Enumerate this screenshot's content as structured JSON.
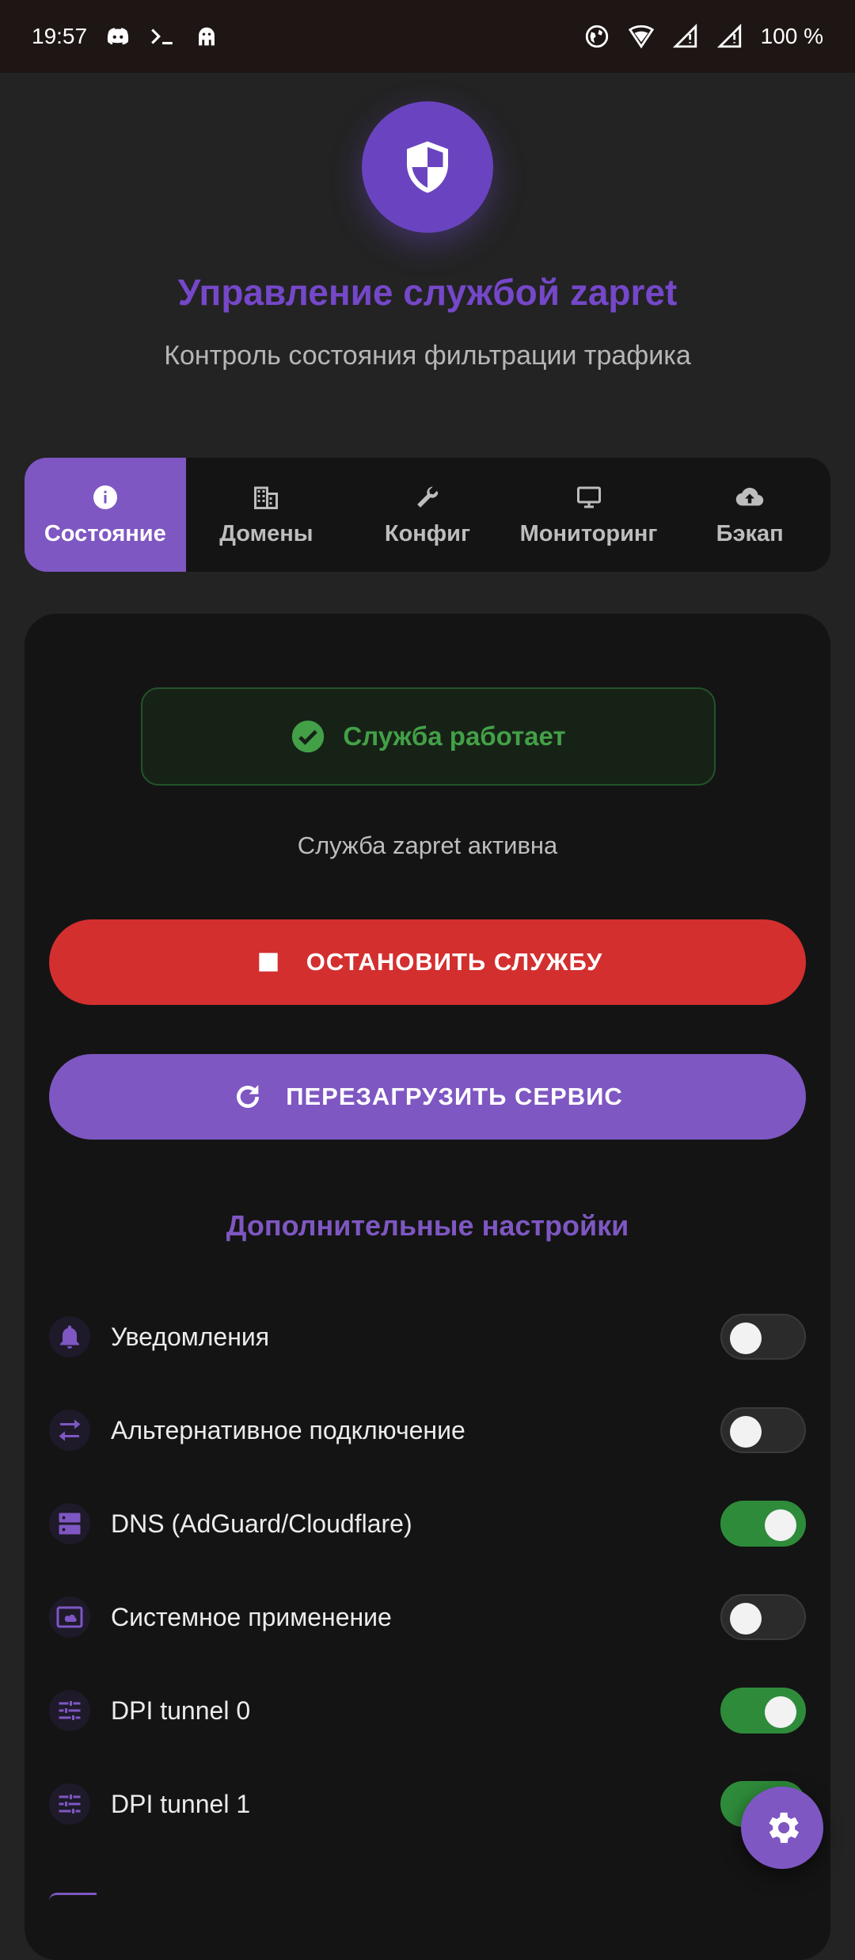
{
  "status_bar": {
    "time": "19:57",
    "battery": "100 %",
    "left_icons": [
      "discord-icon",
      "terminal-icon",
      "android-icon"
    ],
    "right_icons": [
      "vpn-globe-icon",
      "wifi-icon",
      "signal-icon",
      "signal-icon"
    ]
  },
  "header": {
    "title": "Управление службой zapret",
    "subtitle": "Контроль состояния фильтрации трафика",
    "logo_icon": "shield-icon"
  },
  "tabs": [
    {
      "label": "Состояние",
      "icon": "info-icon",
      "active": true
    },
    {
      "label": "Домены",
      "icon": "building-icon",
      "active": false
    },
    {
      "label": "Конфиг",
      "icon": "wrench-icon",
      "active": false
    },
    {
      "label": "Мониторинг",
      "icon": "monitor-icon",
      "active": false
    },
    {
      "label": "Бэкап",
      "icon": "cloud-upload-icon",
      "active": false
    }
  ],
  "service": {
    "status_text": "Служба работает",
    "description": "Служба zapret активна",
    "stop_label": "ОСТАНОВИТЬ СЛУЖБУ",
    "restart_label": "ПЕРЕЗАГРУЗИТЬ СЕРВИС"
  },
  "settings": {
    "title": "Дополнительные настройки",
    "items": [
      {
        "label": "Уведомления",
        "icon": "bell-icon",
        "enabled": false
      },
      {
        "label": "Альтернативное подключение",
        "icon": "swap-icon",
        "enabled": false
      },
      {
        "label": "DNS (AdGuard/Cloudflare)",
        "icon": "server-icon",
        "enabled": true
      },
      {
        "label": "Системное применение",
        "icon": "cloud-screen-icon",
        "enabled": false
      },
      {
        "label": "DPI tunnel 0",
        "icon": "tune-icon",
        "enabled": true
      },
      {
        "label": "DPI tunnel 1",
        "icon": "tune-icon",
        "enabled": true
      }
    ]
  },
  "colors": {
    "accent": "#7e57c2",
    "title": "#7547c9",
    "stop": "#d32f2f",
    "success": "#43a047",
    "toggle_on": "#2e8b3a"
  },
  "fab_icon": "settings-gear-icon"
}
